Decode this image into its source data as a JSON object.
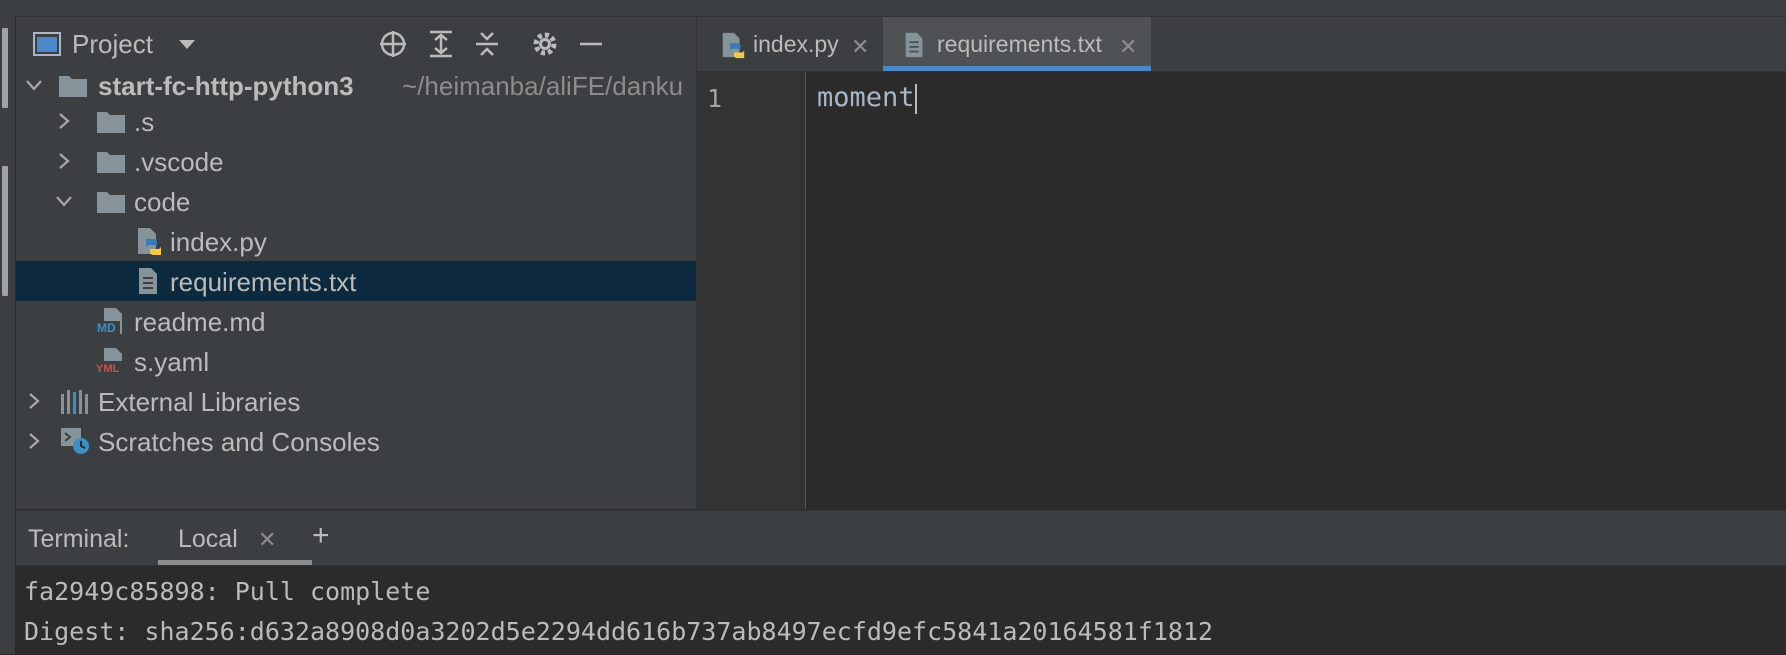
{
  "project_panel": {
    "title": "Project",
    "tree": [
      {
        "label": "start-fc-http-python3",
        "path": "~/heimanba/aliFE/danku",
        "icon": "folder-icon",
        "expanded": true,
        "bold": true
      },
      {
        "label": ".s",
        "icon": "folder-icon",
        "expanded": false
      },
      {
        "label": ".vscode",
        "icon": "folder-icon",
        "expanded": false
      },
      {
        "label": "code",
        "icon": "folder-icon",
        "expanded": true
      },
      {
        "label": "index.py",
        "icon": "python-file-icon"
      },
      {
        "label": "requirements.txt",
        "icon": "text-file-icon",
        "selected": true
      },
      {
        "label": "readme.md",
        "icon": "markdown-file-icon",
        "badge": "MD"
      },
      {
        "label": "s.yaml",
        "icon": "yaml-file-icon",
        "badge": "YML"
      },
      {
        "label": "External Libraries",
        "icon": "libraries-icon",
        "expanded": false
      },
      {
        "label": "Scratches and Consoles",
        "icon": "scratches-icon",
        "expanded": false
      }
    ]
  },
  "editor": {
    "tabs": [
      {
        "label": "index.py",
        "icon": "python-file-icon",
        "active": false
      },
      {
        "label": "requirements.txt",
        "icon": "text-file-icon",
        "active": true
      }
    ],
    "line_number": "1",
    "code_line": "moment"
  },
  "terminal": {
    "title": "Terminal:",
    "tab_label": "Local",
    "add_label": "+",
    "lines": [
      "fa2949c85898: Pull complete",
      "Digest: sha256:d632a8908d0a3202d5e2294dd616b737ab8497ecfd9efc5841a20164581f1812"
    ]
  },
  "colors": {
    "panel_bg": "#3c3f41",
    "editor_bg": "#2b2b2b",
    "selection_bg": "#0d293e",
    "active_tab_underline": "#4a88c7"
  }
}
